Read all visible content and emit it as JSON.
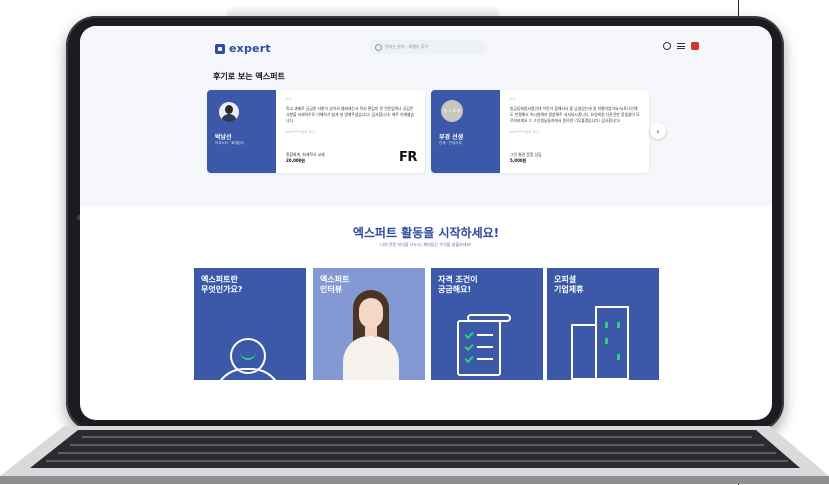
{
  "header": {
    "logo_text": "expert",
    "search_placeholder": "원하는 분야 · 레벨이 찾기"
  },
  "reviews": {
    "title": "후기로 보는 엑스퍼트",
    "cards": [
      {
        "name": "박남선",
        "meta": "이코노미 · 회계감사",
        "quote": "“”",
        "text": "학교 과제로 궁금한 사항이 있어서 클래에는서 먹서 편입미 관 전문업력나 공감전사항을 서래하우로 이해하기 쉽게 설 명해주셨습니다! 감사합니다! 재주 이해했습니다",
        "user": "bsd*****님의 후기",
        "product": "종합회계, 회계학사 교재",
        "price": "20,000원",
        "brand": "FR"
      },
      {
        "name": "부경 선생",
        "meta": "관세 · 관세사무",
        "avatar_label": "용 스 회 에",
        "quote": "“”",
        "text": "방금등회원서원인데 이런거 참해서서 좀 낯설었는데 정 하행가업이요!뉴토너인해도 친절해고 속시원해지 말씀해주 셔서되시겠니다. 요일희원 다른것만 몽생겼어 모르어보게요 ㅎ ㅎ선생님들과에서 원으면 너무좋겠습니다! 감사합니다!",
        "user": "bsd*****님의 후기",
        "product": "그린 통관 문점 상담",
        "price": "5,000원"
      }
    ],
    "next_symbol": "›"
  },
  "cta": {
    "title": "엑스퍼트 활동을 시작하세요!",
    "subtitle": "나의 전문 지식을 나누고, 재미있는 수익을 창출하세요!"
  },
  "tiles": [
    {
      "line1": "엑스퍼트란",
      "line2": "무엇인가요?"
    },
    {
      "line1": "엑스퍼트",
      "line2": "인터뷰"
    },
    {
      "line1": "자격 조건이",
      "line2": "궁금해요!"
    },
    {
      "line1": "오피셜",
      "line2": "기업제휴"
    }
  ],
  "colors": {
    "brand_blue": "#3c59a9",
    "accent_green": "#2fd07a",
    "notification_red": "#d9342b"
  }
}
